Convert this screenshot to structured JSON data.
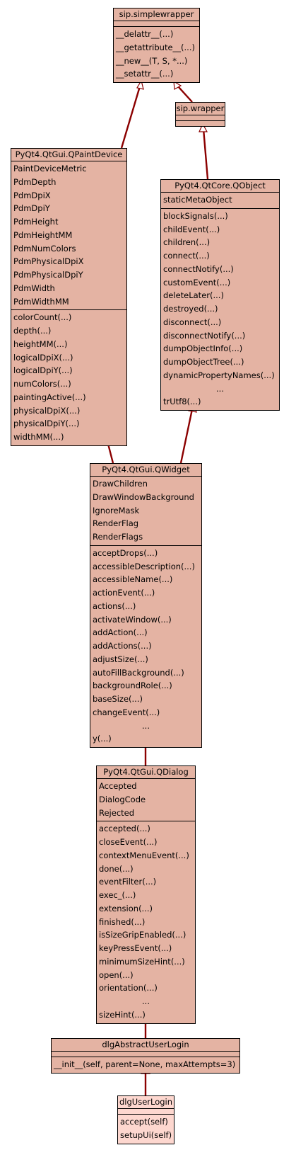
{
  "classes": {
    "simplewrapper": {
      "name": "sip.simplewrapper",
      "attributes": [],
      "methods": [
        "__delattr__(...)",
        "__getattribute__(...)",
        "__new__(T, S, *...)",
        "__setattr__(...)"
      ]
    },
    "wrapper": {
      "name": "sip.wrapper",
      "attributes": [],
      "methods": []
    },
    "qpaintdevice": {
      "name": "PyQt4.QtGui.QPaintDevice",
      "attributes": [
        "PaintDeviceMetric",
        "PdmDepth",
        "PdmDpiX",
        "PdmDpiY",
        "PdmHeight",
        "PdmHeightMM",
        "PdmNumColors",
        "PdmPhysicalDpiX",
        "PdmPhysicalDpiY",
        "PdmWidth",
        "PdmWidthMM"
      ],
      "methods": [
        "colorCount(...)",
        "depth(...)",
        "heightMM(...)",
        "logicalDpiX(...)",
        "logicalDpiY(...)",
        "numColors(...)",
        "paintingActive(...)",
        "physicalDpiX(...)",
        "physicalDpiY(...)",
        "widthMM(...)"
      ]
    },
    "qobject": {
      "name": "PyQt4.QtCore.QObject",
      "attributes": [
        "staticMetaObject"
      ],
      "methods": [
        "blockSignals(...)",
        "childEvent(...)",
        "children(...)",
        "connect(...)",
        "connectNotify(...)",
        "customEvent(...)",
        "deleteLater(...)",
        "destroyed(...)",
        "disconnect(...)",
        "disconnectNotify(...)",
        "dumpObjectInfo(...)",
        "dumpObjectTree(...)",
        "dynamicPropertyNames(...)",
        "...",
        "trUtf8(...)"
      ]
    },
    "qwidget": {
      "name": "PyQt4.QtGui.QWidget",
      "attributes": [
        "DrawChildren",
        "DrawWindowBackground",
        "IgnoreMask",
        "RenderFlag",
        "RenderFlags"
      ],
      "methods": [
        "acceptDrops(...)",
        "accessibleDescription(...)",
        "accessibleName(...)",
        "actionEvent(...)",
        "actions(...)",
        "activateWindow(...)",
        "addAction(...)",
        "addActions(...)",
        "adjustSize(...)",
        "autoFillBackground(...)",
        "backgroundRole(...)",
        "baseSize(...)",
        "changeEvent(...)",
        "...",
        "y(...)"
      ]
    },
    "qdialog": {
      "name": "PyQt4.QtGui.QDialog",
      "attributes": [
        "Accepted",
        "DialogCode",
        "Rejected"
      ],
      "methods": [
        "accepted(...)",
        "closeEvent(...)",
        "contextMenuEvent(...)",
        "done(...)",
        "eventFilter(...)",
        "exec_(...)",
        "extension(...)",
        "finished(...)",
        "isSizeGripEnabled(...)",
        "keyPressEvent(...)",
        "minimumSizeHint(...)",
        "open(...)",
        "orientation(...)",
        "...",
        "sizeHint(...)"
      ]
    },
    "abstractlogin": {
      "name": "dlgAbstractUserLogin",
      "attributes": [],
      "methods": [
        "__init__(self, parent=None, maxAttempts=3)"
      ]
    },
    "userlogin": {
      "name": "dlgUserLogin",
      "attributes": [],
      "methods": [
        "accept(self)",
        "setupUi(self)"
      ]
    }
  },
  "edges": [
    {
      "from": "wrapper",
      "to": "simplewrapper"
    },
    {
      "from": "qpaintdevice",
      "to": "simplewrapper"
    },
    {
      "from": "qobject",
      "to": "wrapper"
    },
    {
      "from": "qwidget",
      "to": "qobject"
    },
    {
      "from": "qwidget",
      "to": "qpaintdevice"
    },
    {
      "from": "qdialog",
      "to": "qwidget"
    },
    {
      "from": "abstractlogin",
      "to": "qdialog"
    },
    {
      "from": "userlogin",
      "to": "abstractlogin"
    }
  ],
  "colors": {
    "class_fill": "#e4b3a3",
    "leaf_fill": "#fdd7cf",
    "edge": "#8b0000"
  }
}
